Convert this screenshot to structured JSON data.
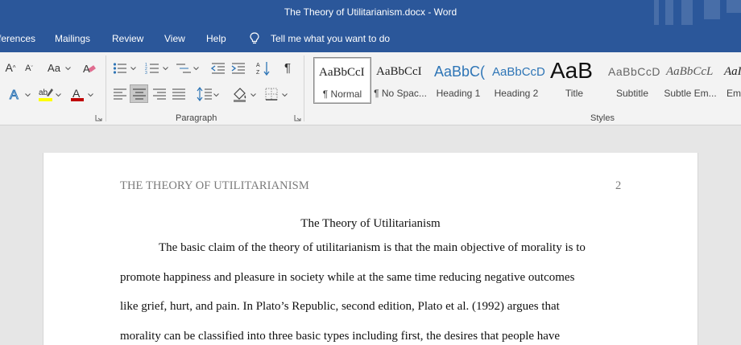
{
  "window": {
    "title": "The Theory of Utilitarianism.docx  -  Word"
  },
  "tabs": {
    "references": "ferences",
    "mailings": "Mailings",
    "review": "Review",
    "view": "View",
    "help": "Help",
    "tell_me": "Tell me what you want to do"
  },
  "ribbon": {
    "font": {
      "change_case": "Aa"
    },
    "paragraph": {
      "label": "Paragraph"
    },
    "styles": {
      "label": "Styles",
      "items": [
        {
          "preview": "AaBbCcI",
          "name": "¶ Normal"
        },
        {
          "preview": "AaBbCcI",
          "name": "¶ No Spac..."
        },
        {
          "preview": "AaBbC(",
          "name": "Heading 1"
        },
        {
          "preview": "AaBbCcD",
          "name": "Heading 2"
        },
        {
          "preview": "AaB",
          "name": "Title"
        },
        {
          "preview": "AaBbCcD",
          "name": "Subtitle"
        },
        {
          "preview": "AaBbCcL",
          "name": "Subtle Em..."
        },
        {
          "preview": "AaI",
          "name": "Em"
        }
      ]
    }
  },
  "document": {
    "header": "THE THEORY OF UTILITARIANISM",
    "page_number": "2",
    "title": "The Theory of Utilitarianism",
    "lines": [
      "The basic claim of the theory of utilitarianism is that the main objective of morality is to",
      "promote happiness and pleasure in society while at the same time reducing negative outcomes",
      "like grief, hurt, and pain. In Plato’s Republic, second edition, Plato et al. (1992) argues that",
      "morality can be classified into three basic types including first, the desires that people have"
    ]
  },
  "colors": {
    "title_bar": "#2b579a",
    "ribbon": "#f3f3f3",
    "canvas": "#e6e6e6",
    "font_color_red": "#c00000",
    "highlight_yellow": "#ffff00"
  }
}
